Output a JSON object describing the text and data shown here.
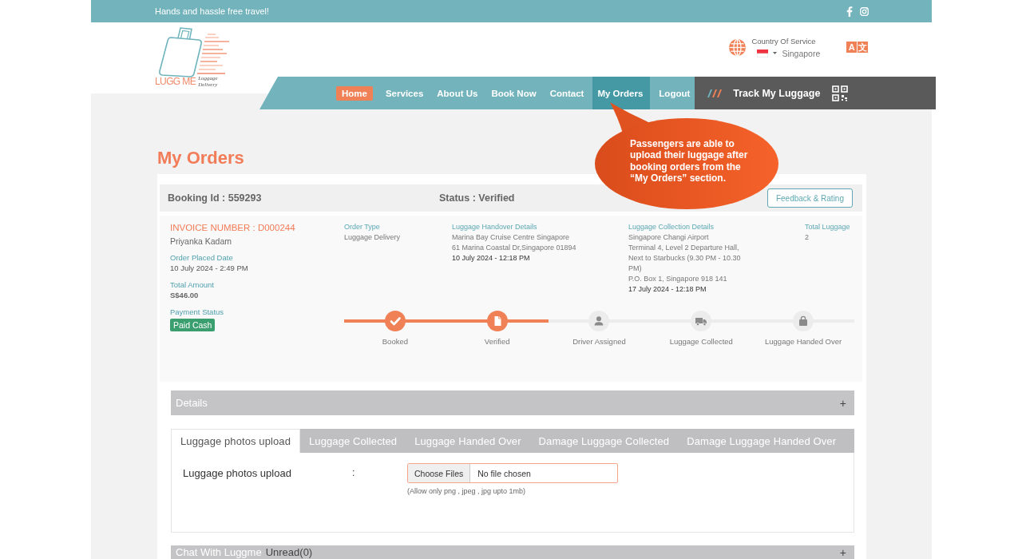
{
  "top_bar": {
    "tagline": "Hands and hassle free travel!"
  },
  "logo": {
    "wordmark": "LUGG ME",
    "tagline": "Luggage Delivery"
  },
  "country": {
    "label": "Country Of Service",
    "value": "Singapore"
  },
  "language": [
    "A",
    "文"
  ],
  "nav": [
    {
      "label": "Home",
      "selected": true,
      "highlighted": false
    },
    {
      "label": "Services",
      "selected": false,
      "highlighted": false
    },
    {
      "label": "About Us",
      "selected": false,
      "highlighted": false
    },
    {
      "label": "Book Now",
      "selected": false,
      "highlighted": false
    },
    {
      "label": "Contact",
      "selected": false,
      "highlighted": false
    },
    {
      "label": "My Orders",
      "selected": false,
      "highlighted": true
    },
    {
      "label": "Logout",
      "selected": false,
      "highlighted": false
    }
  ],
  "track": {
    "label": "Track My Luggage"
  },
  "callout": {
    "text": "Passengers are able to upload their luggage after booking orders from the “My Orders” section."
  },
  "page_title": "My Orders",
  "booking": {
    "id": "Booking Id : 559293",
    "status": "Status : Verified",
    "feedback_button": "Feedback & Rating"
  },
  "order": {
    "invoice": "INVOICE NUMBER : D000244",
    "customer": "Priyanka Kadam",
    "summary": [
      {
        "label": "Order Placed Date",
        "value": "10 July 2024 - 2:49 PM",
        "kind": "text"
      },
      {
        "label": "Total Amount",
        "value": "S$46.00",
        "kind": "amount"
      },
      {
        "label": "Payment Status",
        "value": "Paid Cash",
        "kind": "badge"
      }
    ],
    "info": [
      {
        "label": "Order Type",
        "lines": [
          "Luggage Delivery"
        ]
      },
      {
        "label": "Luggage Handover Details",
        "lines": [
          "Marina Bay Cruise Centre Singapore",
          "61 Marina Coastal Dr,Singapore 01894"
        ],
        "time": "10 July 2024 - 12:18 PM"
      },
      {
        "label": "Luggage Collection Details",
        "lines": [
          "Singapore Changi Airport",
          "Terminal 4, Level 2 Departure Hall, Next to Starbucks (9.30 PM - 10.30 PM)",
          "P.O. Box 1, Singapore 918 141"
        ],
        "time": "17 July 2024 - 12:18 PM"
      },
      {
        "label": "Total Luggage",
        "lines": [
          "2"
        ]
      }
    ],
    "steps": [
      {
        "label": "Booked",
        "done": true
      },
      {
        "label": "Verified",
        "done": true
      },
      {
        "label": "Driver Assigned",
        "done": false
      },
      {
        "label": "Luggage Collected",
        "done": false
      },
      {
        "label": "Luggage Handed Over",
        "done": false
      }
    ]
  },
  "details_section": {
    "title": "Details",
    "toggle": "+"
  },
  "upload_tabs": [
    {
      "label": "Luggage photos upload",
      "selected": true
    },
    {
      "label": "Luggage Collected",
      "selected": false
    },
    {
      "label": "Luggage Handed Over",
      "selected": false
    },
    {
      "label": "Damage Luggage Collected",
      "selected": false
    },
    {
      "label": "Damage Luggage Handed Over",
      "selected": false
    }
  ],
  "upload_panel": {
    "label": "Luggage photos upload",
    "separator": ":",
    "choose_button": "Choose Files",
    "file_status": "No file chosen",
    "hint": "(Allow only png , jpeg , jpg upto 1mb)"
  },
  "chat_section": {
    "title": "Chat With Luggme",
    "unread": "Unread(0)",
    "toggle": "+"
  }
}
